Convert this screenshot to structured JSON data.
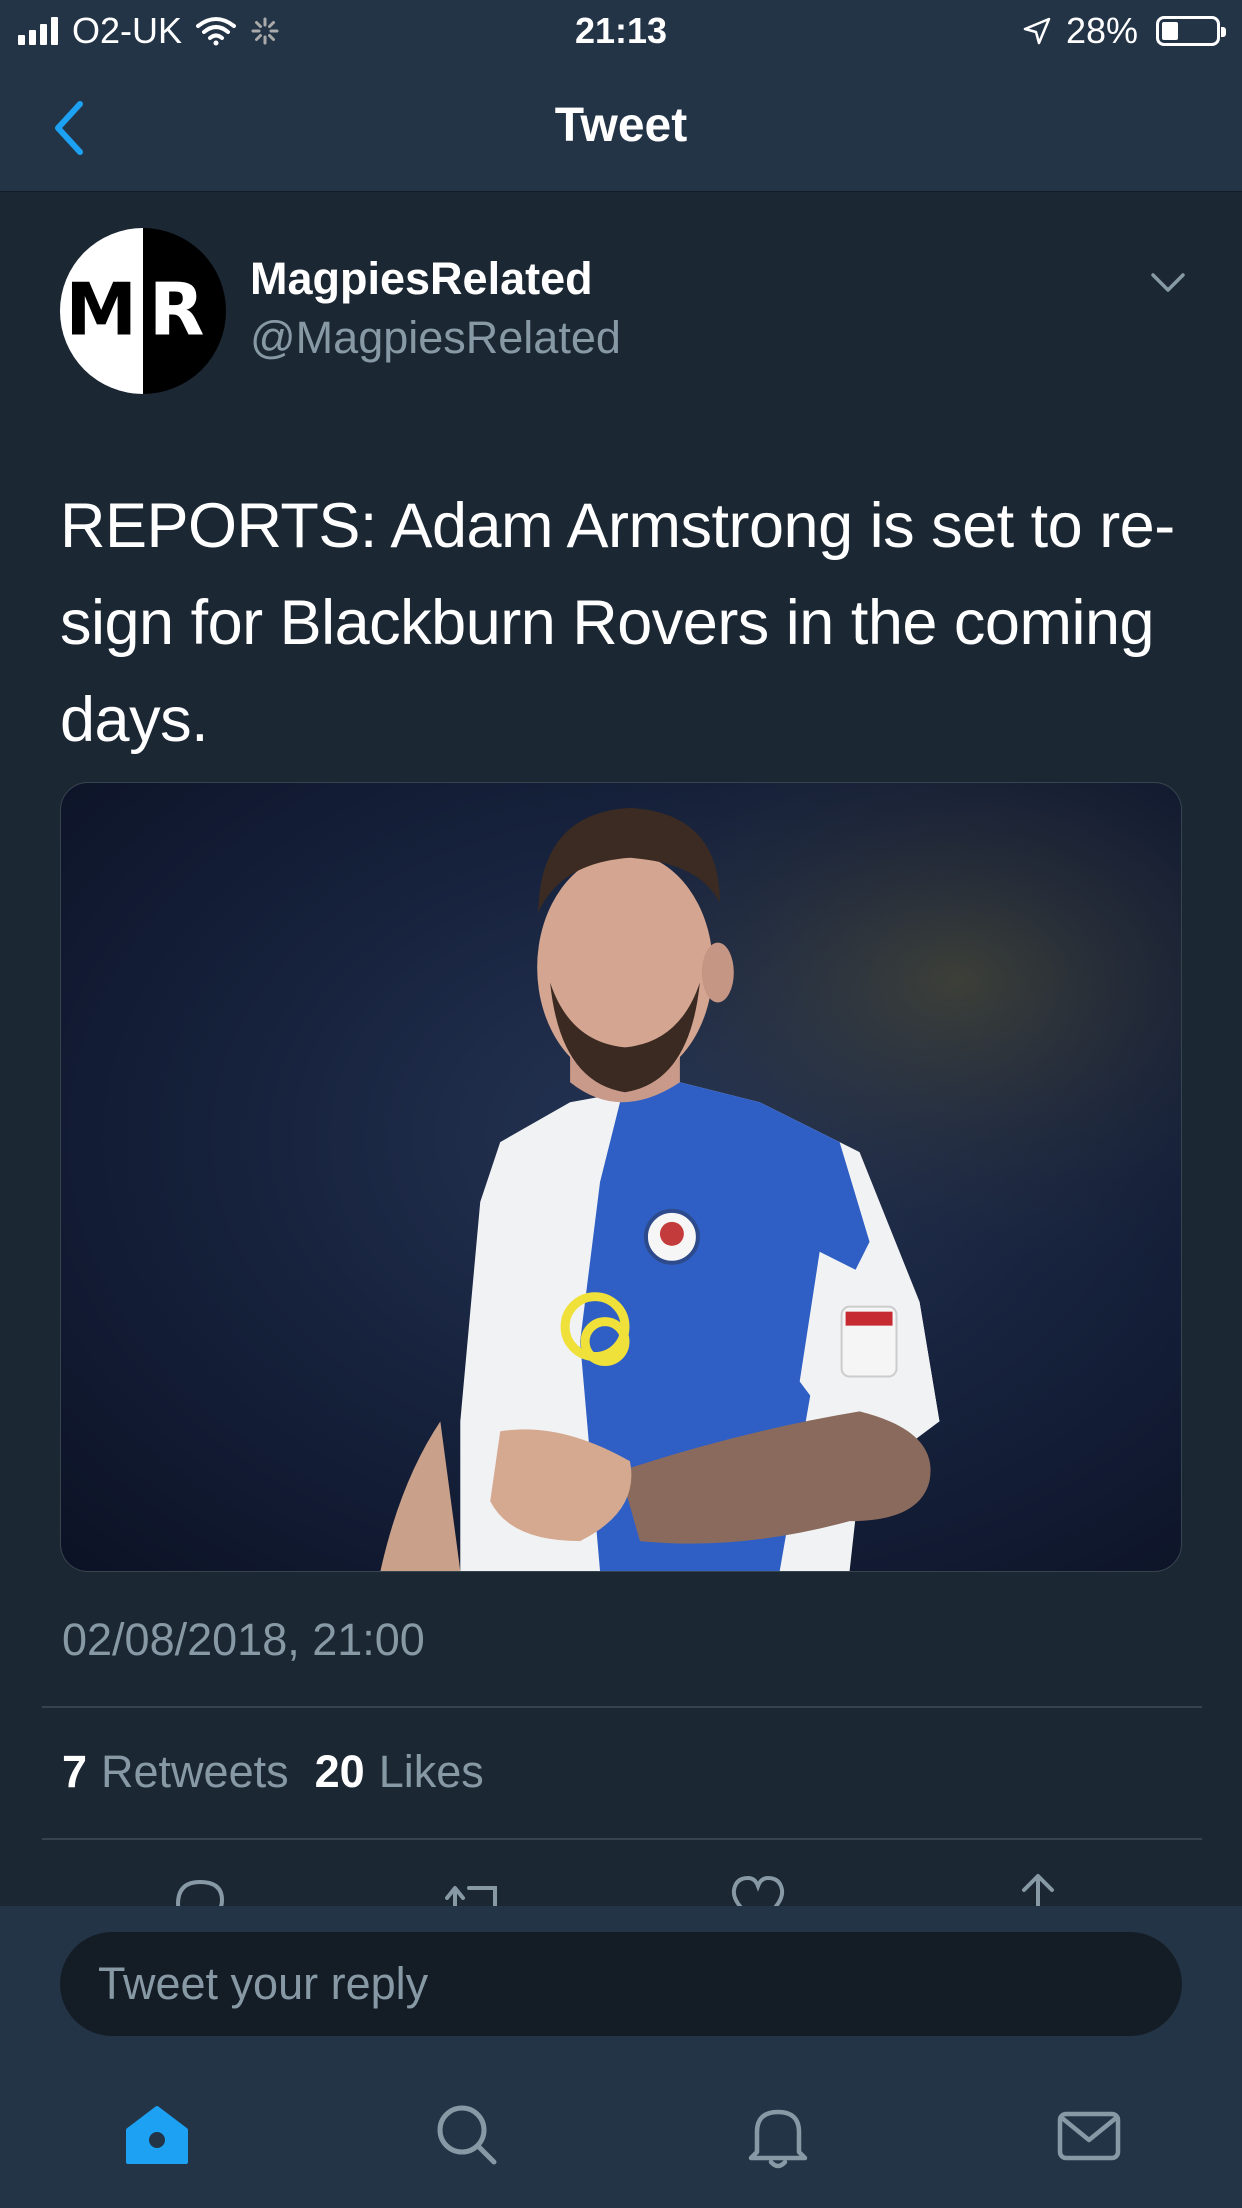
{
  "status_bar": {
    "carrier": "O2-UK",
    "time": "21:13",
    "battery_percent": "28%",
    "battery_level": 0.28
  },
  "nav": {
    "title": "Tweet"
  },
  "tweet": {
    "display_name": "MagpiesRelated",
    "handle": "@MagpiesRelated",
    "avatar_letters": [
      "M",
      "R"
    ],
    "text": "REPORTS: Adam Armstrong is set to re-sign for Blackburn Rovers in the coming days.",
    "timestamp": "02/08/2018, 21:00",
    "retweets_count": "7",
    "retweets_label": "Retweets",
    "likes_count": "20",
    "likes_label": "Likes"
  },
  "reply": {
    "placeholder": "Tweet your reply"
  },
  "icons": {
    "back": "chevron-left-icon",
    "more": "chevron-down-icon",
    "reply": "reply-icon",
    "retweet": "retweet-icon",
    "like": "heart-icon",
    "share": "share-icon",
    "home": "home-icon",
    "search": "search-icon",
    "notifications": "bell-icon",
    "messages": "mail-icon"
  },
  "colors": {
    "accent": "#1da1f2",
    "background": "#1c2734",
    "bar": "#243447",
    "secondary_text": "#8899a6"
  }
}
